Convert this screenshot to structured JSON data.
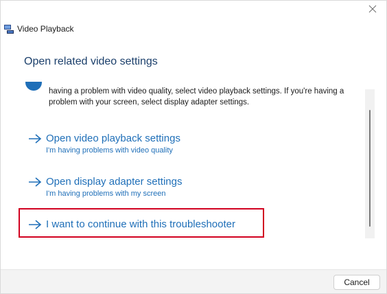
{
  "window": {
    "title": "Video Playback",
    "icon": "video-playback-app-icon",
    "close_icon": "close-icon"
  },
  "page": {
    "heading": "Open related video settings",
    "info_text": "having a problem with video quality, select video playback settings. If you're having a problem with your screen, select display adapter settings.",
    "info_icon": "info-icon"
  },
  "links": [
    {
      "title": "Open video playback settings",
      "subtitle": "I'm having problems with video quality",
      "icon": "arrow-right-icon"
    },
    {
      "title": "Open display adapter settings",
      "subtitle": "I'm having problems with my screen",
      "icon": "arrow-right-icon"
    },
    {
      "title": "I want to continue with this troubleshooter",
      "subtitle": "",
      "icon": "arrow-right-icon",
      "highlighted": true
    }
  ],
  "footer": {
    "cancel_label": "Cancel"
  },
  "colors": {
    "accent": "#1f6fb8",
    "heading": "#1b3f6b",
    "highlight": "#d1001f"
  }
}
